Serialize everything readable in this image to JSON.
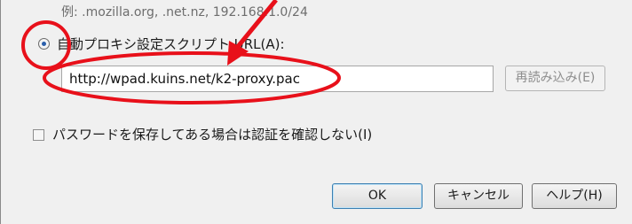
{
  "proxy_settings": {
    "example_hint": "例: .mozilla.org, .net.nz, 192.168.1.0/24",
    "auto_pac_label": "自動プロキシ設定スクリプト URL(A):",
    "auto_pac_selected": true,
    "pac_url_value": "http://wpad.kuins.net/k2-proxy.pac",
    "reload_button": "再読み込み(E)",
    "no_auth_prompt_label": "パスワードを保存してある場合は認証を確認しない(I)",
    "no_auth_prompt_checked": false
  },
  "footer": {
    "ok_label": "OK",
    "cancel_label": "キャンセル",
    "help_label": "ヘルプ(H)"
  },
  "annotations": {
    "color": "#e8101a",
    "shapes": [
      "circle around radio button",
      "ellipse around PAC URL field",
      "arrow pointing to URL field"
    ]
  }
}
